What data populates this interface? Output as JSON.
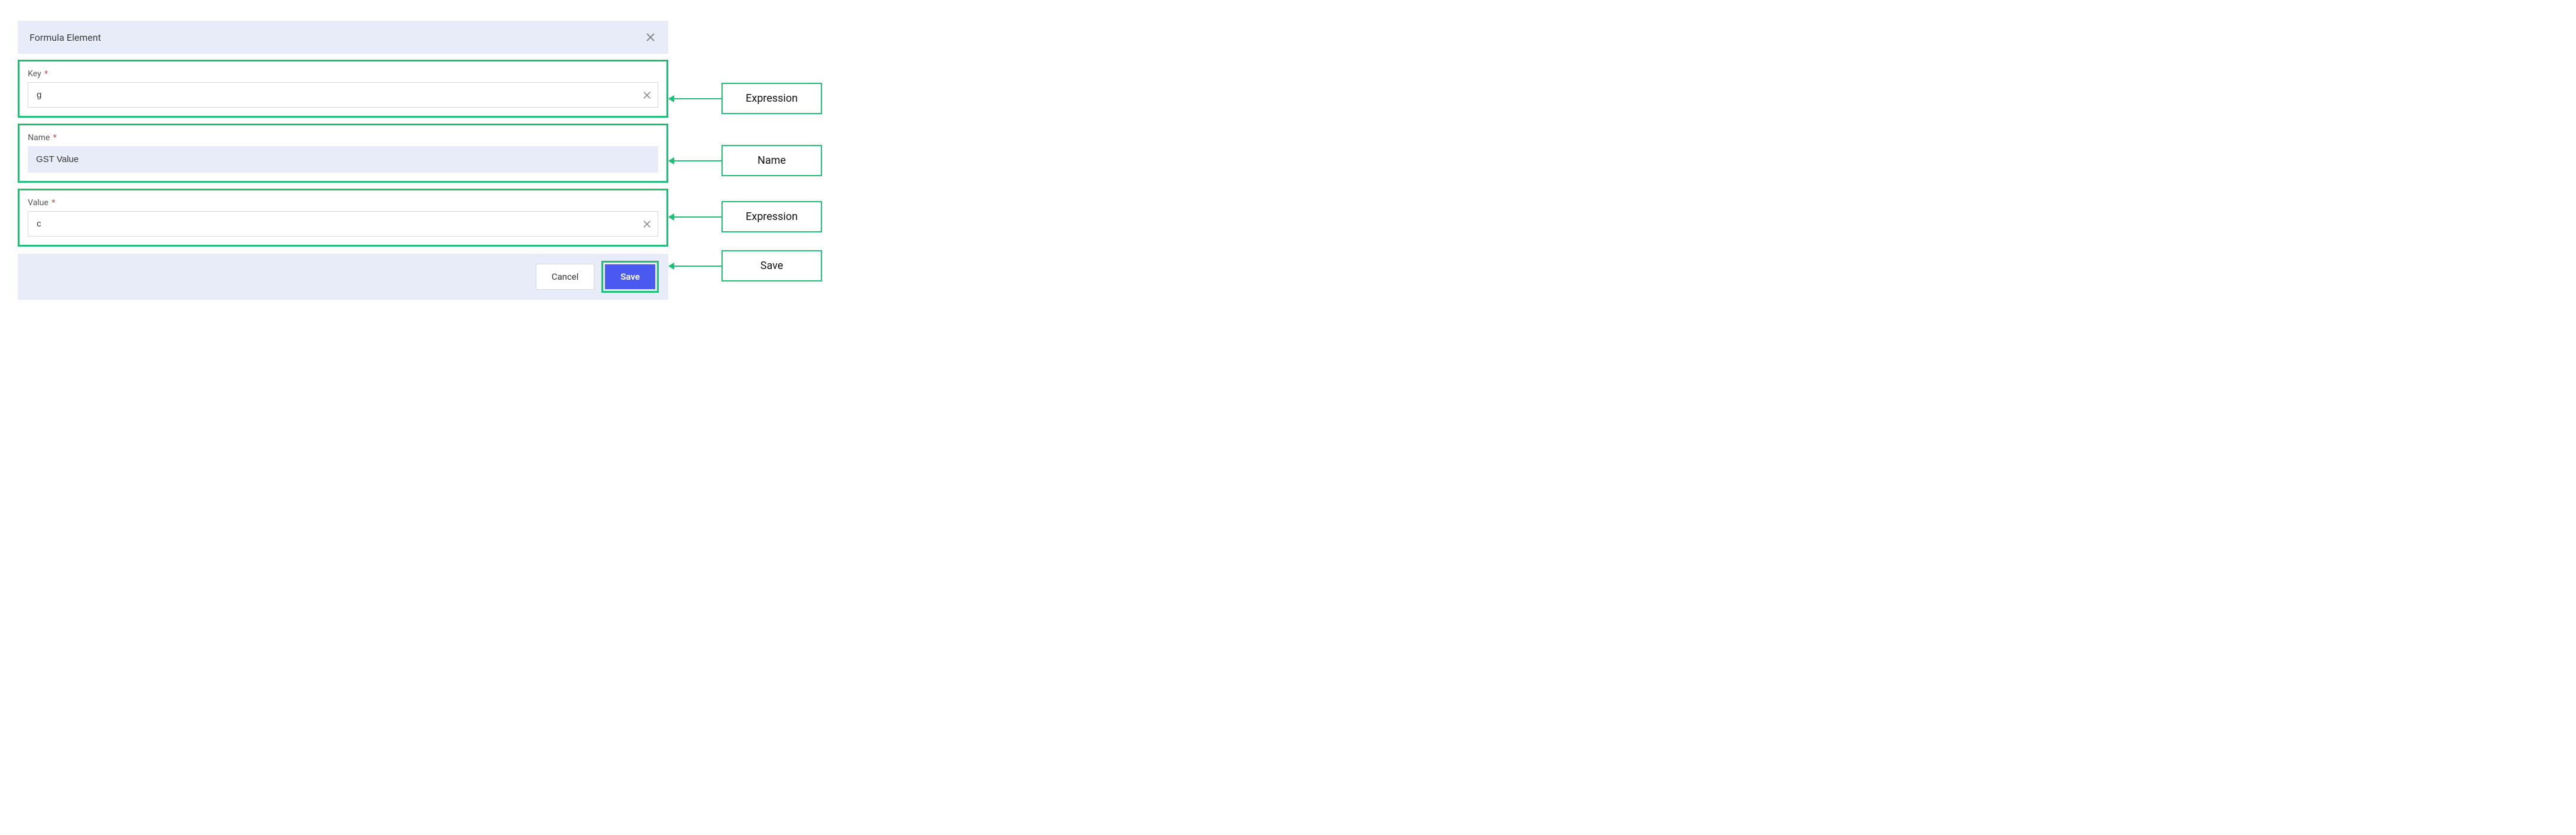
{
  "dialog": {
    "title": "Formula Element"
  },
  "fields": {
    "key": {
      "label": "Key",
      "value": "g"
    },
    "name": {
      "label": "Name",
      "value": "GST Value"
    },
    "value": {
      "label": "Value",
      "value": "c"
    }
  },
  "buttons": {
    "cancel": "Cancel",
    "save": "Save"
  },
  "annotations": {
    "key": "Expression",
    "name": "Name",
    "value": "Expression",
    "save": "Save"
  }
}
